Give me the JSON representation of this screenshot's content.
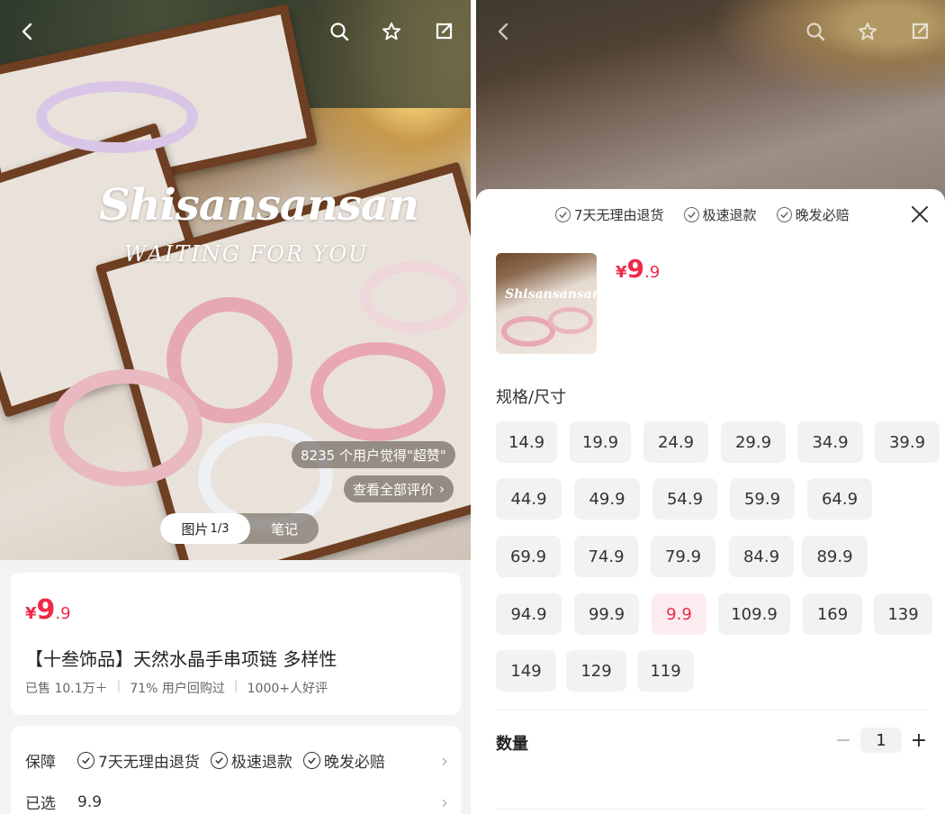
{
  "top_actions": [
    "back-icon",
    "search-icon",
    "star-icon",
    "share-icon"
  ],
  "gallery": {
    "watermark_line1": "Shisansansan",
    "watermark_line2": "WAITING FOR YOU",
    "likes_text": "8235 个用户觉得\"超赞\"",
    "reviews_link": "查看全部评价",
    "tab_photo": "图片",
    "tab_photo_count": "1/3",
    "tab_notes": "笔记"
  },
  "product": {
    "currency": "¥",
    "price_int": "9",
    "price_dec": ".9",
    "title": "【十叁饰品】天然水晶手串项链 多样性",
    "stats": [
      "已售 10.1万＋",
      "71% 用户回购过",
      "1000+人好评"
    ]
  },
  "service": {
    "guarantee_label": "保障",
    "guarantees": [
      "7天无理由退货",
      "极速退款",
      "晚发必赔"
    ],
    "selected_label": "已选",
    "selected_value": "9.9"
  },
  "sheet": {
    "guarantees": [
      "7天无理由退货",
      "极速退款",
      "晚发必赔"
    ],
    "thumb_watermark": "Shisansansan",
    "price_currency": "¥",
    "price_int": "9",
    "price_dec": ".9",
    "spec_label": "规格/尺寸",
    "options": [
      "14.9",
      "19.9",
      "24.9",
      "29.9",
      "34.9",
      "39.9",
      "44.9",
      "49.9",
      "54.9",
      "59.9",
      "64.9",
      "69.9",
      "74.9",
      "79.9",
      "84.9",
      "89.9",
      "94.9",
      "99.9",
      "9.9",
      "109.9",
      "169",
      "139",
      "149",
      "129",
      "119"
    ],
    "selected_option": "9.9",
    "qty_label": "数量",
    "qty_value": "1",
    "minus": "−",
    "plus": "+"
  },
  "colors": {
    "accent": "#ee2a47",
    "selected_bg": "#fdecef"
  }
}
